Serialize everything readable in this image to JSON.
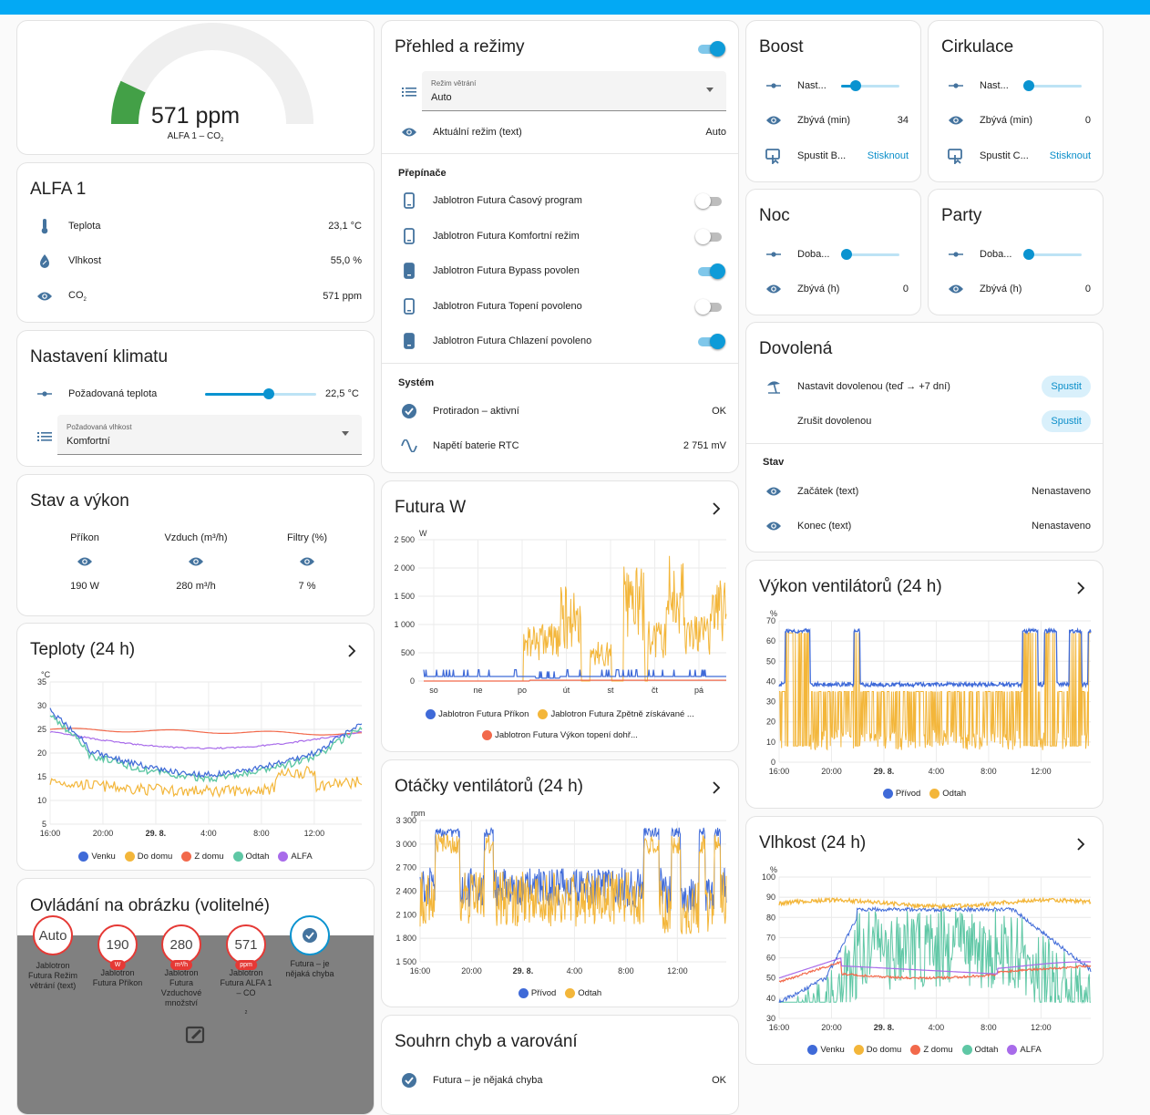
{
  "colors": {
    "accent": "#0a93d0",
    "green": "#43a047",
    "venku": "#3f6ad8",
    "domu": "#f3b63a",
    "zdomu": "#f2694b",
    "odtah": "#5fc7a5",
    "alfa": "#a86bea",
    "red": "#e53935"
  },
  "gauge": {
    "value": "571 ppm",
    "label_main": "ALFA 1 – CO",
    "label_sub": "2",
    "fraction": 0.14
  },
  "alfa1": {
    "title": "ALFA 1",
    "rows": [
      {
        "icon": "thermometer-icon",
        "label": "Teplota",
        "value": "23,1 °C"
      },
      {
        "icon": "water-percent-icon",
        "label": "Vlhkost",
        "value": "55,0 %"
      },
      {
        "icon": "eye-icon",
        "label": "CO",
        "sub": "2",
        "value": "571 ppm"
      }
    ]
  },
  "klima": {
    "title": "Nastavení klimatu",
    "temp_label": "Požadovaná teplota",
    "temp_value": "22,5 °C",
    "temp_fraction": 0.57,
    "hum_small": "Požadovaná vlhkost",
    "hum_value": "Komfortní"
  },
  "stav": {
    "title": "Stav a výkon",
    "cols": [
      {
        "label": "Příkon",
        "value": "190 W"
      },
      {
        "label": "Vzduch (m³/h)",
        "value": "280 m³/h"
      },
      {
        "label": "Filtry (%)",
        "value": "7 %"
      }
    ]
  },
  "teploty": {
    "title": "Teploty (24 h)",
    "unit": "°C",
    "yticks": [
      "35",
      "30",
      "25",
      "20",
      "15",
      "10",
      "5"
    ],
    "xticks": [
      "16:00",
      "20:00",
      "29. 8.",
      "4:00",
      "8:00",
      "12:00"
    ],
    "legend": [
      {
        "name": "Venku",
        "color": "#3f6ad8"
      },
      {
        "name": "Do domu",
        "color": "#f3b63a"
      },
      {
        "name": "Z domu",
        "color": "#f2694b"
      },
      {
        "name": "Odtah",
        "color": "#5fc7a5"
      },
      {
        "name": "ALFA",
        "color": "#a86bea"
      }
    ]
  },
  "ovladani": {
    "title": "Ovládání na obrázku (volitelné)",
    "badges": [
      {
        "value": "Auto",
        "unit": "",
        "label": "Jablotron Futura Režim větrání (text)"
      },
      {
        "value": "190",
        "unit": "W",
        "label": "Jablotron Futura Příkon"
      },
      {
        "value": "280",
        "unit": "m³/h",
        "label": "Jablotron Futura Vzduchové množství"
      },
      {
        "value": "571",
        "unit": "ppm",
        "label": "Jablotron Futura ALFA 1 – CO"
      },
      {
        "value": "",
        "unit": "",
        "label": "Futura – je nějaká chyba"
      }
    ],
    "label_sub_co2": "2"
  },
  "prehled": {
    "title": "Přehled a režimy",
    "mode_small": "Režim větrání",
    "mode_value": "Auto",
    "current_label": "Aktuální režim (text)",
    "current_value": "Auto",
    "switches_header": "Přepínače",
    "switches": [
      {
        "label": "Jablotron Futura Časový program",
        "on": false
      },
      {
        "label": "Jablotron Futura Komfortní režim",
        "on": false
      },
      {
        "label": "Jablotron Futura Bypass povolen",
        "on": true
      },
      {
        "label": "Jablotron Futura Topení povoleno",
        "on": false
      },
      {
        "label": "Jablotron Futura Chlazení povoleno",
        "on": true
      }
    ],
    "system_header": "Systém",
    "system": [
      {
        "label": "Protiradon – aktivní",
        "value": "OK"
      },
      {
        "label": "Napětí baterie RTC",
        "value": "2 751 mV"
      }
    ]
  },
  "futura_w": {
    "title": "Futura W",
    "unit": "W",
    "yticks": [
      "2 500",
      "2 000",
      "1 500",
      "1 000",
      "500",
      "0"
    ],
    "xticks": [
      "so",
      "ne",
      "po",
      "út",
      "st",
      "čt",
      "pá"
    ],
    "legend": [
      {
        "name": "Jablotron Futura Příkon",
        "color": "#3f6ad8"
      },
      {
        "name": "Jablotron Futura Zpětně získávané ...",
        "color": "#f3b63a"
      },
      {
        "name": "Jablotron Futura Výkon topení dohř...",
        "color": "#f2694b"
      }
    ]
  },
  "otacky": {
    "title": "Otáčky ventilátorů (24 h)",
    "unit": "rpm",
    "yticks": [
      "3 300",
      "3 000",
      "2 700",
      "2 400",
      "2 100",
      "1 800",
      "1 500"
    ],
    "xticks": [
      "16:00",
      "20:00",
      "29. 8.",
      "4:00",
      "8:00",
      "12:00"
    ],
    "legend": [
      {
        "name": "Přívod",
        "color": "#3f6ad8"
      },
      {
        "name": "Odtah",
        "color": "#f3b63a"
      }
    ]
  },
  "chyby": {
    "title": "Souhrn chyb a varování",
    "rows": [
      {
        "label": "Futura – je nějaká chyba",
        "value": "OK"
      }
    ]
  },
  "boost": {
    "title": "Boost",
    "set_label": "Nast...",
    "set_fraction": 0.25,
    "remain_label": "Zbývá (min)",
    "remain_value": "34",
    "run_label": "Spustit B...",
    "run_btn": "Stisknout"
  },
  "cirkulace": {
    "title": "Cirkulace",
    "set_label": "Nast...",
    "set_fraction": 0.0,
    "remain_label": "Zbývá (min)",
    "remain_value": "0",
    "run_label": "Spustit C...",
    "run_btn": "Stisknout"
  },
  "noc": {
    "title": "Noc",
    "set_label": "Doba...",
    "set_fraction": 0.0,
    "remain_label": "Zbývá (h)",
    "remain_value": "0"
  },
  "party": {
    "title": "Party",
    "set_label": "Doba...",
    "set_fraction": 0.0,
    "remain_label": "Zbývá (h)",
    "remain_value": "0"
  },
  "dovolena": {
    "title": "Dovolená",
    "set_label": "Nastavit dovolenou (teď → +7 dní)",
    "set_btn": "Spustit",
    "cancel_label": "Zrušit dovolenou",
    "cancel_btn": "Spustit",
    "state_header": "Stav",
    "start_label": "Začátek (text)",
    "start_value": "Nenastaveno",
    "end_label": "Konec (text)",
    "end_value": "Nenastaveno"
  },
  "vykon": {
    "title": "Výkon ventilátorů (24 h)",
    "unit": "%",
    "yticks": [
      "70",
      "60",
      "50",
      "40",
      "30",
      "20",
      "10",
      "0"
    ],
    "xticks": [
      "16:00",
      "20:00",
      "29. 8.",
      "4:00",
      "8:00",
      "12:00"
    ],
    "legend": [
      {
        "name": "Přívod",
        "color": "#3f6ad8"
      },
      {
        "name": "Odtah",
        "color": "#f3b63a"
      }
    ]
  },
  "vlhkost": {
    "title": "Vlhkost (24 h)",
    "unit": "%",
    "yticks": [
      "100",
      "90",
      "80",
      "70",
      "60",
      "50",
      "40",
      "30"
    ],
    "xticks": [
      "16:00",
      "20:00",
      "29. 8.",
      "4:00",
      "8:00",
      "12:00"
    ],
    "legend": [
      {
        "name": "Venku",
        "color": "#3f6ad8"
      },
      {
        "name": "Do domu",
        "color": "#f3b63a"
      },
      {
        "name": "Z domu",
        "color": "#f2694b"
      },
      {
        "name": "Odtah",
        "color": "#5fc7a5"
      },
      {
        "name": "ALFA",
        "color": "#a86bea"
      }
    ]
  }
}
